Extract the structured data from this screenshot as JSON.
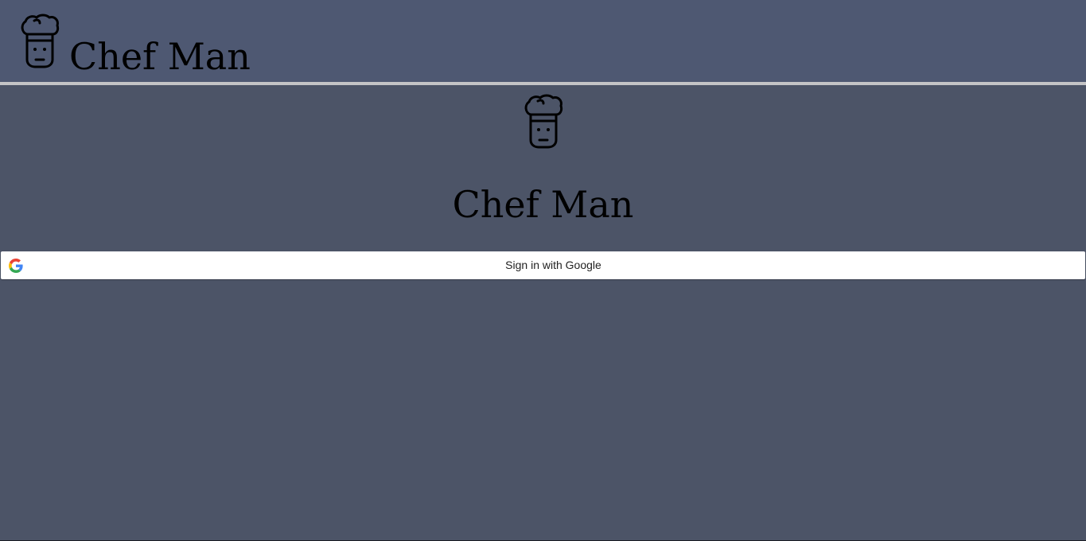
{
  "header": {
    "logo_icon": "chef-hat-face-icon",
    "title": "Chef Man"
  },
  "main": {
    "logo_icon": "chef-hat-face-icon",
    "title": "Chef Man",
    "signin": {
      "icon": "google-g-icon",
      "label": "Sign in with Google"
    }
  },
  "colors": {
    "header_bg": "#4e5872",
    "main_bg": "#4c5467",
    "divider": "#c4c4c6",
    "button_bg": "#ffffff",
    "text": "#000000"
  }
}
